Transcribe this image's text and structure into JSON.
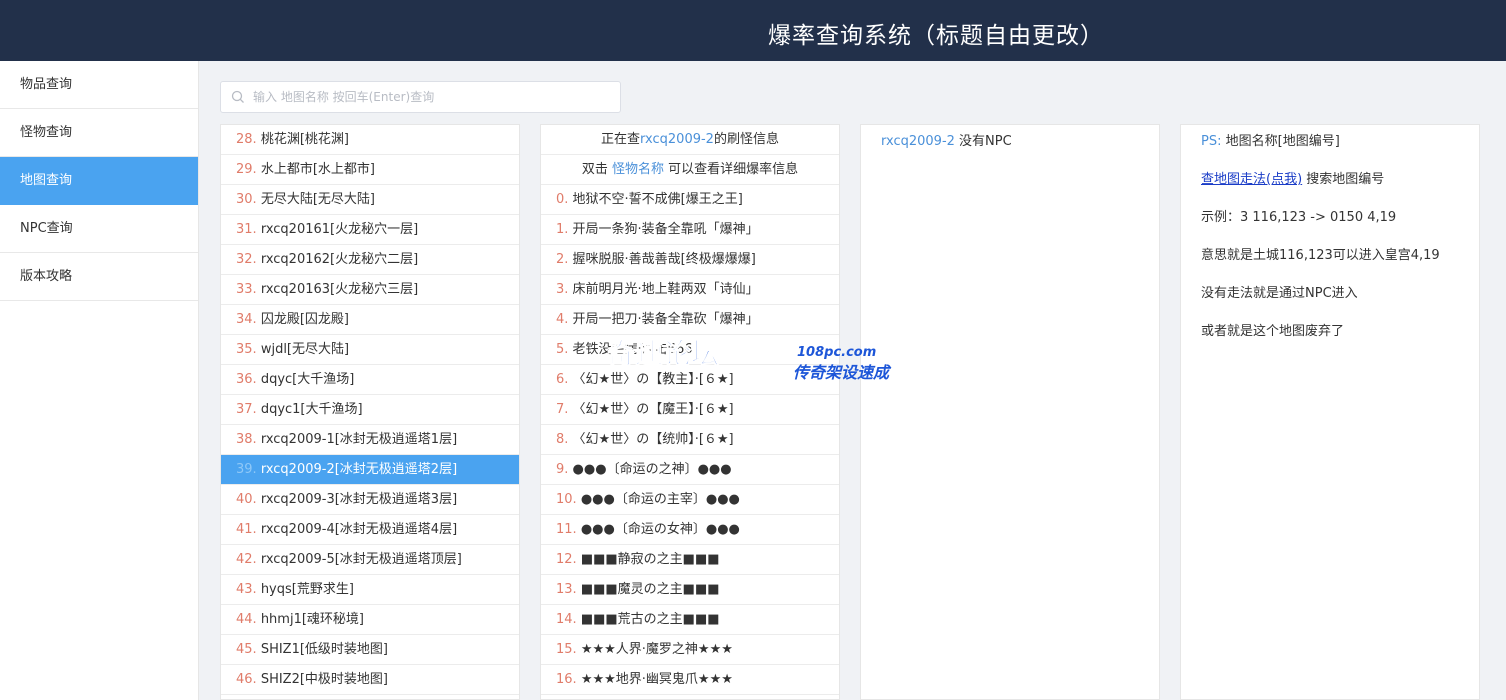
{
  "header": {
    "title": "爆率查询系统（标题自由更改）"
  },
  "sidebar": {
    "items": [
      {
        "label": "物品查询"
      },
      {
        "label": "怪物查询"
      },
      {
        "label": "地图查询"
      },
      {
        "label": "NPC查询"
      },
      {
        "label": "版本攻略"
      }
    ],
    "active_index": 2
  },
  "search": {
    "placeholder": "输入 地图名称 按回车(Enter)查询",
    "value": ""
  },
  "map_list": {
    "selected_index": 11,
    "items": [
      {
        "index": "28.",
        "name": " 桃花渊[桃花渊]"
      },
      {
        "index": "29.",
        "name": " 水上都市[水上都市]"
      },
      {
        "index": "30.",
        "name": " 无尽大陆[无尽大陆]"
      },
      {
        "index": "31.",
        "name": " rxcq20161[火龙秘穴一层]"
      },
      {
        "index": "32.",
        "name": " rxcq20162[火龙秘穴二层]"
      },
      {
        "index": "33.",
        "name": " rxcq20163[火龙秘穴三层]"
      },
      {
        "index": "34.",
        "name": " 囚龙殿[囚龙殿]"
      },
      {
        "index": "35.",
        "name": " wjdl[无尽大陆]"
      },
      {
        "index": "36.",
        "name": " dqyc[大千渔场]"
      },
      {
        "index": "37.",
        "name": " dqyc1[大千渔场]"
      },
      {
        "index": "38.",
        "name": " rxcq2009-1[冰封无极逍遥塔1层]"
      },
      {
        "index": "39.",
        "name": " rxcq2009-2[冰封无极逍遥塔2层]"
      },
      {
        "index": "40.",
        "name": " rxcq2009-3[冰封无极逍遥塔3层]"
      },
      {
        "index": "41.",
        "name": " rxcq2009-4[冰封无极逍遥塔4层]"
      },
      {
        "index": "42.",
        "name": " rxcq2009-5[冰封无极逍遥塔顶层]"
      },
      {
        "index": "43.",
        "name": " hyqs[荒野求生]"
      },
      {
        "index": "44.",
        "name": " hhmj1[魂环秘境]"
      },
      {
        "index": "45.",
        "name": " SHIZ1[低级时装地图]"
      },
      {
        "index": "46.",
        "name": " SHIZ2[中极时装地图]"
      }
    ]
  },
  "monster_panel": {
    "header_prefix": "正在查",
    "header_map": "rxcq2009-2",
    "header_suffix": "的刷怪信息",
    "hint_prefix": "双击",
    "hint_link": "怪物名称",
    "hint_suffix": "可以查看详细爆率信息",
    "items": [
      {
        "index": "0.",
        "name": " 地狱不空·誓不成佛[爆王之王]"
      },
      {
        "index": "1.",
        "name": " 开局一条狗·装备全靠吼「爆神」"
      },
      {
        "index": "2.",
        "name": " 握咪脱服·善哉善哉[终极爆爆爆]"
      },
      {
        "index": "3.",
        "name": " 床前明月光·地上鞋两双「诗仙」"
      },
      {
        "index": "4.",
        "name": " 开局一把刀·装备全靠砍「爆神」"
      },
      {
        "index": "5.",
        "name": " 老铁没毛病·双击666"
      },
      {
        "index": "6.",
        "name": " 〈幻★世〉の【教主】·[６★]"
      },
      {
        "index": "7.",
        "name": " 〈幻★世〉の【魔王】·[６★]"
      },
      {
        "index": "8.",
        "name": " 〈幻★世〉の【统帅】·[６★]"
      },
      {
        "index": "9.",
        "name": " ●●●〔命运の之神〕●●●"
      },
      {
        "index": "10.",
        "name": " ●●●〔命运の主宰〕●●●"
      },
      {
        "index": "11.",
        "name": " ●●●〔命运の女神〕●●●"
      },
      {
        "index": "12.",
        "name": " ■■■静寂の之主■■■"
      },
      {
        "index": "13.",
        "name": " ■■■魔灵の之主■■■"
      },
      {
        "index": "14.",
        "name": " ■■■荒古の之主■■■"
      },
      {
        "index": "15.",
        "name": " ★★★人界·魔罗之神★★★"
      },
      {
        "index": "16.",
        "name": " ★★★地界·幽冥鬼爪★★★"
      }
    ]
  },
  "npc_panel": {
    "map": "rxcq2009-2",
    "text": " 没有NPC"
  },
  "help_panel": {
    "ps_label": "PS:",
    "ps_text": " 地图名称[地图编号]",
    "link_text": "查地图走法(点我)",
    "link_suffix": " 搜索地图编号",
    "example": "示例：3 116,123 -> 0150 4,19",
    "meaning": "意思就是土城116,123可以进入皇宫4,19",
    "note1": "没有走法就是通过NPC进入",
    "note2": "或者就是这个地图废弃了"
  },
  "watermark": {
    "main": "奇速论坛",
    "domain": "108pc.com",
    "slogan": "传奇架设速成"
  },
  "colors": {
    "header_bg": "#22304a",
    "accent": "#4aa3f0",
    "index": "#e07c6a",
    "link_blue": "#4a90d9"
  }
}
